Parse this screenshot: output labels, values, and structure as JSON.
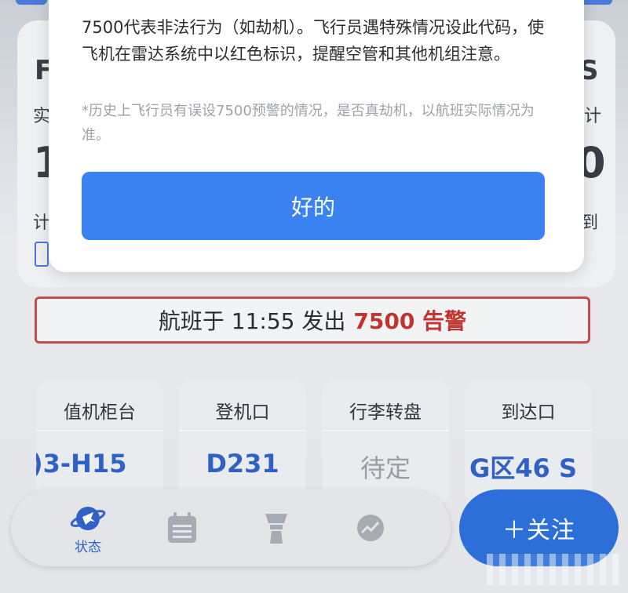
{
  "flight_card": {
    "edge_left_1": "F",
    "edge_left_2": "实",
    "edge_left_3": "1",
    "edge_left_4": "计",
    "edge_right_1": "S",
    "edge_right_2": "计",
    "edge_right_3": "0",
    "edge_right_4": "到"
  },
  "alert": {
    "prefix": "航班于 11:55 发出",
    "code": "7500 告警"
  },
  "tiles": [
    {
      "label": "值机柜台",
      "value": ")3-H15"
    },
    {
      "label": "登机口",
      "value": "D231"
    },
    {
      "label": "行李转盘",
      "value": "待定"
    },
    {
      "label": "到达口",
      "value": "G区46   S"
    }
  ],
  "tabbar": {
    "status_label": "状态"
  },
  "follow_button": "＋关注",
  "modal": {
    "description": "7500代表非法行为（如劫机）。飞行员遇特殊情况设此代码，使飞机在雷达系统中以红色标识，提醒空管和其他机组注意。",
    "note": "*历史上飞行员有误设7500预警的情况，是否真劫机，以航班实际情况为准。",
    "ok_label": "好的"
  },
  "colors": {
    "accent": "#3a82f0",
    "alert_red": "#c2332f",
    "tile_value_blue": "#2f62c4"
  }
}
